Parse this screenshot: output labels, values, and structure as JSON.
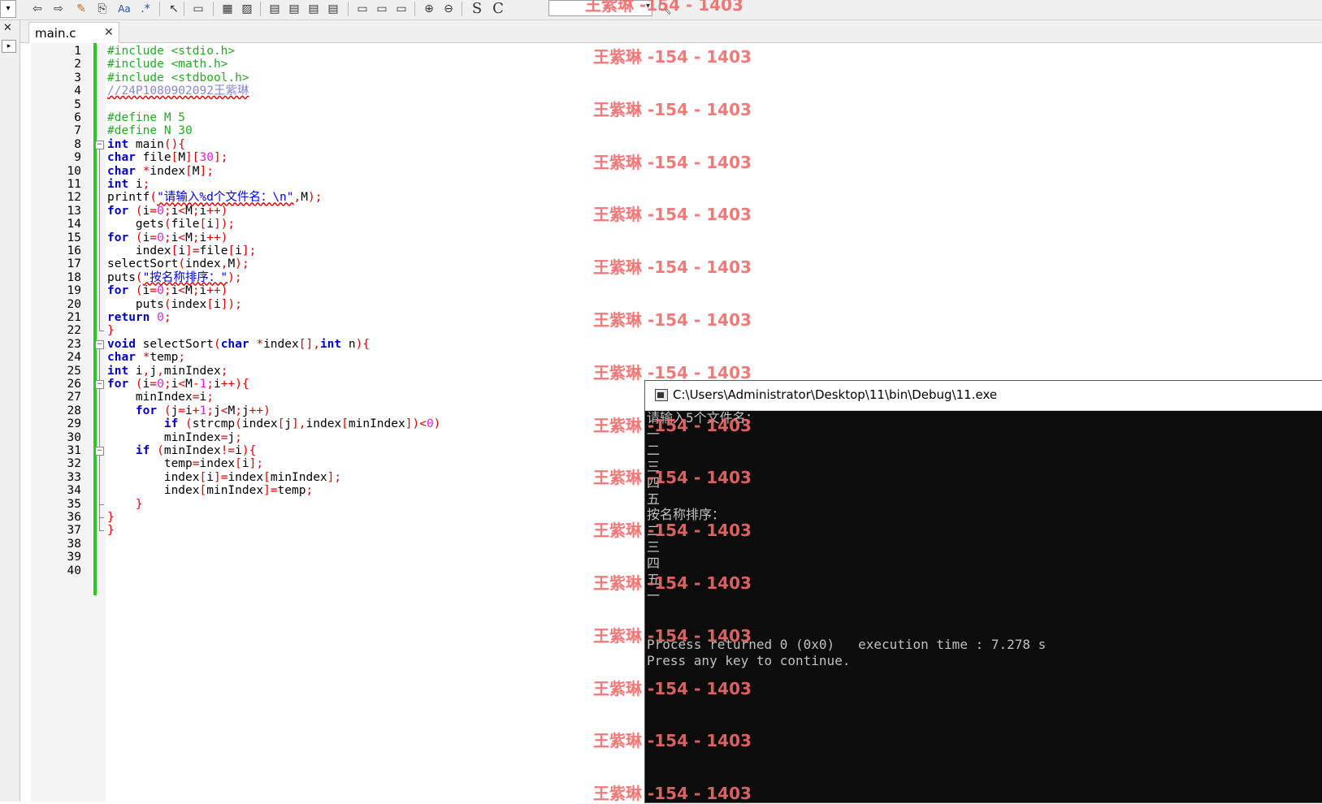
{
  "toolbar": {
    "icons": [
      "back-icon",
      "forward-icon",
      "highlight-icon",
      "replace-icon",
      "match-case-icon",
      "regex-icon",
      "select-icon",
      "block-icon",
      "layout1-icon",
      "layout2-icon",
      "layout3-icon",
      "layout4-icon",
      "layout5-icon",
      "layout6-icon",
      "frame1-icon",
      "frame2-icon",
      "frame3-icon",
      "zoom-in-icon",
      "zoom-out-icon"
    ],
    "aa_label": "Aa",
    "regex_label": ".*",
    "s_label": "S",
    "c_label": "C",
    "combo_value": ""
  },
  "tab": {
    "label": "main.c",
    "close": "✕"
  },
  "left_panel": {
    "close": "✕",
    "arrow": "▸"
  },
  "editor": {
    "line_numbers": [
      "1",
      "2",
      "3",
      "4",
      "5",
      "6",
      "7",
      "8",
      "9",
      "10",
      "11",
      "12",
      "13",
      "14",
      "15",
      "16",
      "17",
      "18",
      "19",
      "20",
      "21",
      "22",
      "23",
      "24",
      "25",
      "26",
      "27",
      "28",
      "29",
      "30",
      "31",
      "32",
      "33",
      "34",
      "35",
      "36",
      "37",
      "38",
      "39",
      "40"
    ],
    "lines": [
      [
        [
          "pp",
          "#include <stdio.h>"
        ]
      ],
      [
        [
          "pp",
          "#include <math.h>"
        ]
      ],
      [
        [
          "pp",
          "#include <stdbool.h>"
        ]
      ],
      [
        [
          "cm",
          "//24P1080902092王紫琳"
        ]
      ],
      [],
      [
        [
          "pp",
          "#define M 5"
        ]
      ],
      [
        [
          "pp",
          "#define N 30"
        ]
      ],
      [
        [
          "kw",
          "int"
        ],
        [
          "id",
          " main"
        ],
        [
          "op",
          "(){"
        ]
      ],
      [
        [
          "kw",
          "char"
        ],
        [
          "id",
          " file"
        ],
        [
          "op",
          "["
        ],
        [
          "id",
          "M"
        ],
        [
          "op",
          "]["
        ],
        [
          "num",
          "30"
        ],
        [
          "op",
          "];"
        ]
      ],
      [
        [
          "kw",
          "char"
        ],
        [
          "id",
          " "
        ],
        [
          "op",
          "*"
        ],
        [
          "id",
          "index"
        ],
        [
          "op",
          "["
        ],
        [
          "id",
          "M"
        ],
        [
          "op",
          "];"
        ]
      ],
      [
        [
          "kw",
          "int"
        ],
        [
          "id",
          " i"
        ],
        [
          "op",
          ";"
        ]
      ],
      [
        [
          "id",
          "printf"
        ],
        [
          "op",
          "("
        ],
        [
          "str",
          "\"请输入%d个文件名：\\n\""
        ],
        [
          "op",
          ","
        ],
        [
          "id",
          "M"
        ],
        [
          "op",
          ");"
        ]
      ],
      [
        [
          "kw",
          "for"
        ],
        [
          "op",
          " ("
        ],
        [
          "id",
          "i"
        ],
        [
          "op",
          "="
        ],
        [
          "num",
          "0"
        ],
        [
          "op",
          ";"
        ],
        [
          "id",
          "i"
        ],
        [
          "op",
          "<"
        ],
        [
          "id",
          "M"
        ],
        [
          "op",
          ";"
        ],
        [
          "id",
          "i"
        ],
        [
          "op",
          "++)"
        ]
      ],
      [
        [
          "id",
          "    gets"
        ],
        [
          "op",
          "("
        ],
        [
          "id",
          "file"
        ],
        [
          "op",
          "["
        ],
        [
          "id",
          "i"
        ],
        [
          "op",
          "]);"
        ]
      ],
      [
        [
          "kw",
          "for"
        ],
        [
          "op",
          " ("
        ],
        [
          "id",
          "i"
        ],
        [
          "op",
          "="
        ],
        [
          "num",
          "0"
        ],
        [
          "op",
          ";"
        ],
        [
          "id",
          "i"
        ],
        [
          "op",
          "<"
        ],
        [
          "id",
          "M"
        ],
        [
          "op",
          ";"
        ],
        [
          "id",
          "i"
        ],
        [
          "op",
          "++)"
        ]
      ],
      [
        [
          "id",
          "    index"
        ],
        [
          "op",
          "["
        ],
        [
          "id",
          "i"
        ],
        [
          "op",
          "]="
        ],
        [
          "id",
          "file"
        ],
        [
          "op",
          "["
        ],
        [
          "id",
          "i"
        ],
        [
          "op",
          "];"
        ]
      ],
      [
        [
          "id",
          "selectSort"
        ],
        [
          "op",
          "("
        ],
        [
          "id",
          "index"
        ],
        [
          "op",
          ","
        ],
        [
          "id",
          "M"
        ],
        [
          "op",
          ");"
        ]
      ],
      [
        [
          "id",
          "puts"
        ],
        [
          "op",
          "("
        ],
        [
          "str",
          "\"按名称排序：\""
        ],
        [
          "op",
          ");"
        ]
      ],
      [
        [
          "kw",
          "for"
        ],
        [
          "op",
          " ("
        ],
        [
          "id",
          "i"
        ],
        [
          "op",
          "="
        ],
        [
          "num",
          "0"
        ],
        [
          "op",
          ";"
        ],
        [
          "id",
          "i"
        ],
        [
          "op",
          "<"
        ],
        [
          "id",
          "M"
        ],
        [
          "op",
          ";"
        ],
        [
          "id",
          "i"
        ],
        [
          "op",
          "++)"
        ]
      ],
      [
        [
          "id",
          "    puts"
        ],
        [
          "op",
          "("
        ],
        [
          "id",
          "index"
        ],
        [
          "op",
          "["
        ],
        [
          "id",
          "i"
        ],
        [
          "op",
          "]);"
        ]
      ],
      [
        [
          "kw",
          "return"
        ],
        [
          "id",
          " "
        ],
        [
          "num",
          "0"
        ],
        [
          "op",
          ";"
        ]
      ],
      [
        [
          "op",
          "}"
        ]
      ],
      [
        [
          "kw",
          "void"
        ],
        [
          "id",
          " selectSort"
        ],
        [
          "op",
          "("
        ],
        [
          "kw",
          "char"
        ],
        [
          "id",
          " "
        ],
        [
          "op",
          "*"
        ],
        [
          "id",
          "index"
        ],
        [
          "op",
          "[],"
        ],
        [
          "kw",
          "int"
        ],
        [
          "id",
          " n"
        ],
        [
          "op",
          "){"
        ]
      ],
      [
        [
          "kw",
          "char"
        ],
        [
          "id",
          " "
        ],
        [
          "op",
          "*"
        ],
        [
          "id",
          "temp"
        ],
        [
          "op",
          ";"
        ]
      ],
      [
        [
          "kw",
          "int"
        ],
        [
          "id",
          " i"
        ],
        [
          "op",
          ","
        ],
        [
          "id",
          "j"
        ],
        [
          "op",
          ","
        ],
        [
          "id",
          "minIndex"
        ],
        [
          "op",
          ";"
        ]
      ],
      [
        [
          "kw",
          "for"
        ],
        [
          "op",
          " ("
        ],
        [
          "id",
          "i"
        ],
        [
          "op",
          "="
        ],
        [
          "num",
          "0"
        ],
        [
          "op",
          ";"
        ],
        [
          "id",
          "i"
        ],
        [
          "op",
          "<"
        ],
        [
          "id",
          "M"
        ],
        [
          "op",
          "-"
        ],
        [
          "num",
          "1"
        ],
        [
          "op",
          ";"
        ],
        [
          "id",
          "i"
        ],
        [
          "op",
          "++){"
        ]
      ],
      [
        [
          "id",
          "    minIndex"
        ],
        [
          "op",
          "="
        ],
        [
          "id",
          "i"
        ],
        [
          "op",
          ";"
        ]
      ],
      [
        [
          "kw",
          "    for"
        ],
        [
          "op",
          " ("
        ],
        [
          "id",
          "j"
        ],
        [
          "op",
          "="
        ],
        [
          "id",
          "i"
        ],
        [
          "op",
          "+"
        ],
        [
          "num",
          "1"
        ],
        [
          "op",
          ";"
        ],
        [
          "id",
          "j"
        ],
        [
          "op",
          "<"
        ],
        [
          "id",
          "M"
        ],
        [
          "op",
          ";"
        ],
        [
          "id",
          "j"
        ],
        [
          "op",
          "++)"
        ]
      ],
      [
        [
          "kw",
          "        if"
        ],
        [
          "op",
          " ("
        ],
        [
          "id",
          "strcmp"
        ],
        [
          "op",
          "("
        ],
        [
          "id",
          "index"
        ],
        [
          "op",
          "["
        ],
        [
          "id",
          "j"
        ],
        [
          "op",
          "],"
        ],
        [
          "id",
          "index"
        ],
        [
          "op",
          "["
        ],
        [
          "id",
          "minIndex"
        ],
        [
          "op",
          "])<"
        ],
        [
          "num",
          "0"
        ],
        [
          "op",
          ")"
        ]
      ],
      [
        [
          "id",
          "        minIndex"
        ],
        [
          "op",
          "="
        ],
        [
          "id",
          "j"
        ],
        [
          "op",
          ";"
        ]
      ],
      [
        [
          "kw",
          "    if"
        ],
        [
          "op",
          " ("
        ],
        [
          "id",
          "minIndex"
        ],
        [
          "op",
          "!="
        ],
        [
          "id",
          "i"
        ],
        [
          "op",
          "){"
        ]
      ],
      [
        [
          "id",
          "        temp"
        ],
        [
          "op",
          "="
        ],
        [
          "id",
          "index"
        ],
        [
          "op",
          "["
        ],
        [
          "id",
          "i"
        ],
        [
          "op",
          "];"
        ]
      ],
      [
        [
          "id",
          "        index"
        ],
        [
          "op",
          "["
        ],
        [
          "id",
          "i"
        ],
        [
          "op",
          "]="
        ],
        [
          "id",
          "index"
        ],
        [
          "op",
          "["
        ],
        [
          "id",
          "minIndex"
        ],
        [
          "op",
          "];"
        ]
      ],
      [
        [
          "id",
          "        index"
        ],
        [
          "op",
          "["
        ],
        [
          "id",
          "minIndex"
        ],
        [
          "op",
          "]="
        ],
        [
          "id",
          "temp"
        ],
        [
          "op",
          ";"
        ]
      ],
      [
        [
          "op",
          "    }"
        ]
      ],
      [
        [
          "op",
          "}"
        ]
      ],
      [
        [
          "op",
          "}"
        ]
      ],
      [],
      [],
      []
    ]
  },
  "watermark": {
    "text": "王紫琳 -154 - 1403",
    "color": "#f26a6a"
  },
  "console": {
    "title": "C:\\Users\\Administrator\\Desktop\\11\\bin\\Debug\\11.exe",
    "lines": [
      "请输入5个文件名：",
      "一",
      "二",
      "三",
      "四",
      "五",
      "按名称排序：",
      "二",
      "三",
      "四",
      "五",
      "一",
      "",
      "",
      "Process returned 0 (0x0)   execution time : 7.278 s",
      "Press any key to continue."
    ]
  },
  "colors": {
    "preprocessor": "#22aa22",
    "keyword": "#0000cc",
    "operator": "#dd0000",
    "number": "#dd22dd",
    "change_bar": "#22cc22",
    "console_bg": "#0c0c0c"
  }
}
